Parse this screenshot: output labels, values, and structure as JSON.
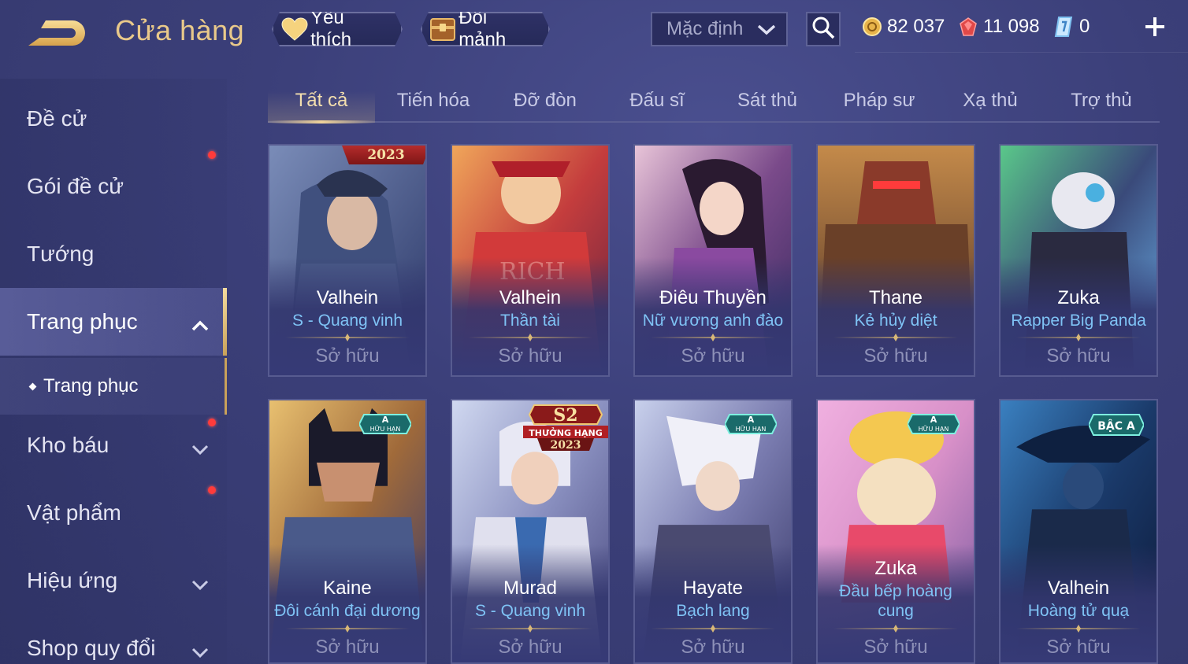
{
  "header": {
    "title": "Cửa hàng",
    "favorites_label": "Yêu thích",
    "exchange_label": "Đổi mảnh",
    "sort_value": "Mặc định",
    "currencies": [
      {
        "name": "gold-coin",
        "value": "82 037",
        "color": "#e8b44a"
      },
      {
        "name": "ruby",
        "value": "11 098",
        "color": "#e04848"
      },
      {
        "name": "voucher",
        "value": "0",
        "color": "#7ec0f0"
      }
    ]
  },
  "sidebar": {
    "items": [
      {
        "label": "Đề cử"
      },
      {
        "label": "Gói đề cử"
      },
      {
        "label": "Tướng"
      },
      {
        "label": "Trang phục"
      },
      {
        "label": "Kho báu"
      },
      {
        "label": "Vật phẩm"
      },
      {
        "label": "Hiệu ứng"
      },
      {
        "label": "Shop quy đổi"
      }
    ],
    "sub_item": "Trang phục"
  },
  "tabs": [
    "Tất cả",
    "Tiến hóa",
    "Đỡ đòn",
    "Đấu sĩ",
    "Sát thủ",
    "Pháp sư",
    "Xạ thủ",
    "Trợ thủ"
  ],
  "owned_label": "Sở hữu",
  "badges": {
    "limited_top": "A",
    "limited_bottom": "HỮU HẠN",
    "tier": "BẬC A",
    "year": "2023",
    "season": "S2",
    "ranked": "THƯỞNG HẠNG"
  },
  "cards": [
    {
      "hero": "Valhein",
      "skin": "S - Quang vinh"
    },
    {
      "hero": "Valhein",
      "skin": "Thần tài"
    },
    {
      "hero": "Điêu Thuyền",
      "skin": "Nữ vương anh đào"
    },
    {
      "hero": "Thane",
      "skin": "Kẻ hủy diệt"
    },
    {
      "hero": "Zuka",
      "skin": "Rapper Big Panda"
    },
    {
      "hero": "Kaine",
      "skin": "Đôi cánh đại dương"
    },
    {
      "hero": "Murad",
      "skin": "S - Quang vinh"
    },
    {
      "hero": "Hayate",
      "skin": "Bạch lang"
    },
    {
      "hero": "Zuka",
      "skin_line1": "Đầu bếp hoàng",
      "skin_line2": "cung"
    },
    {
      "hero": "Valhein",
      "skin": "Hoàng tử quạ"
    }
  ]
}
